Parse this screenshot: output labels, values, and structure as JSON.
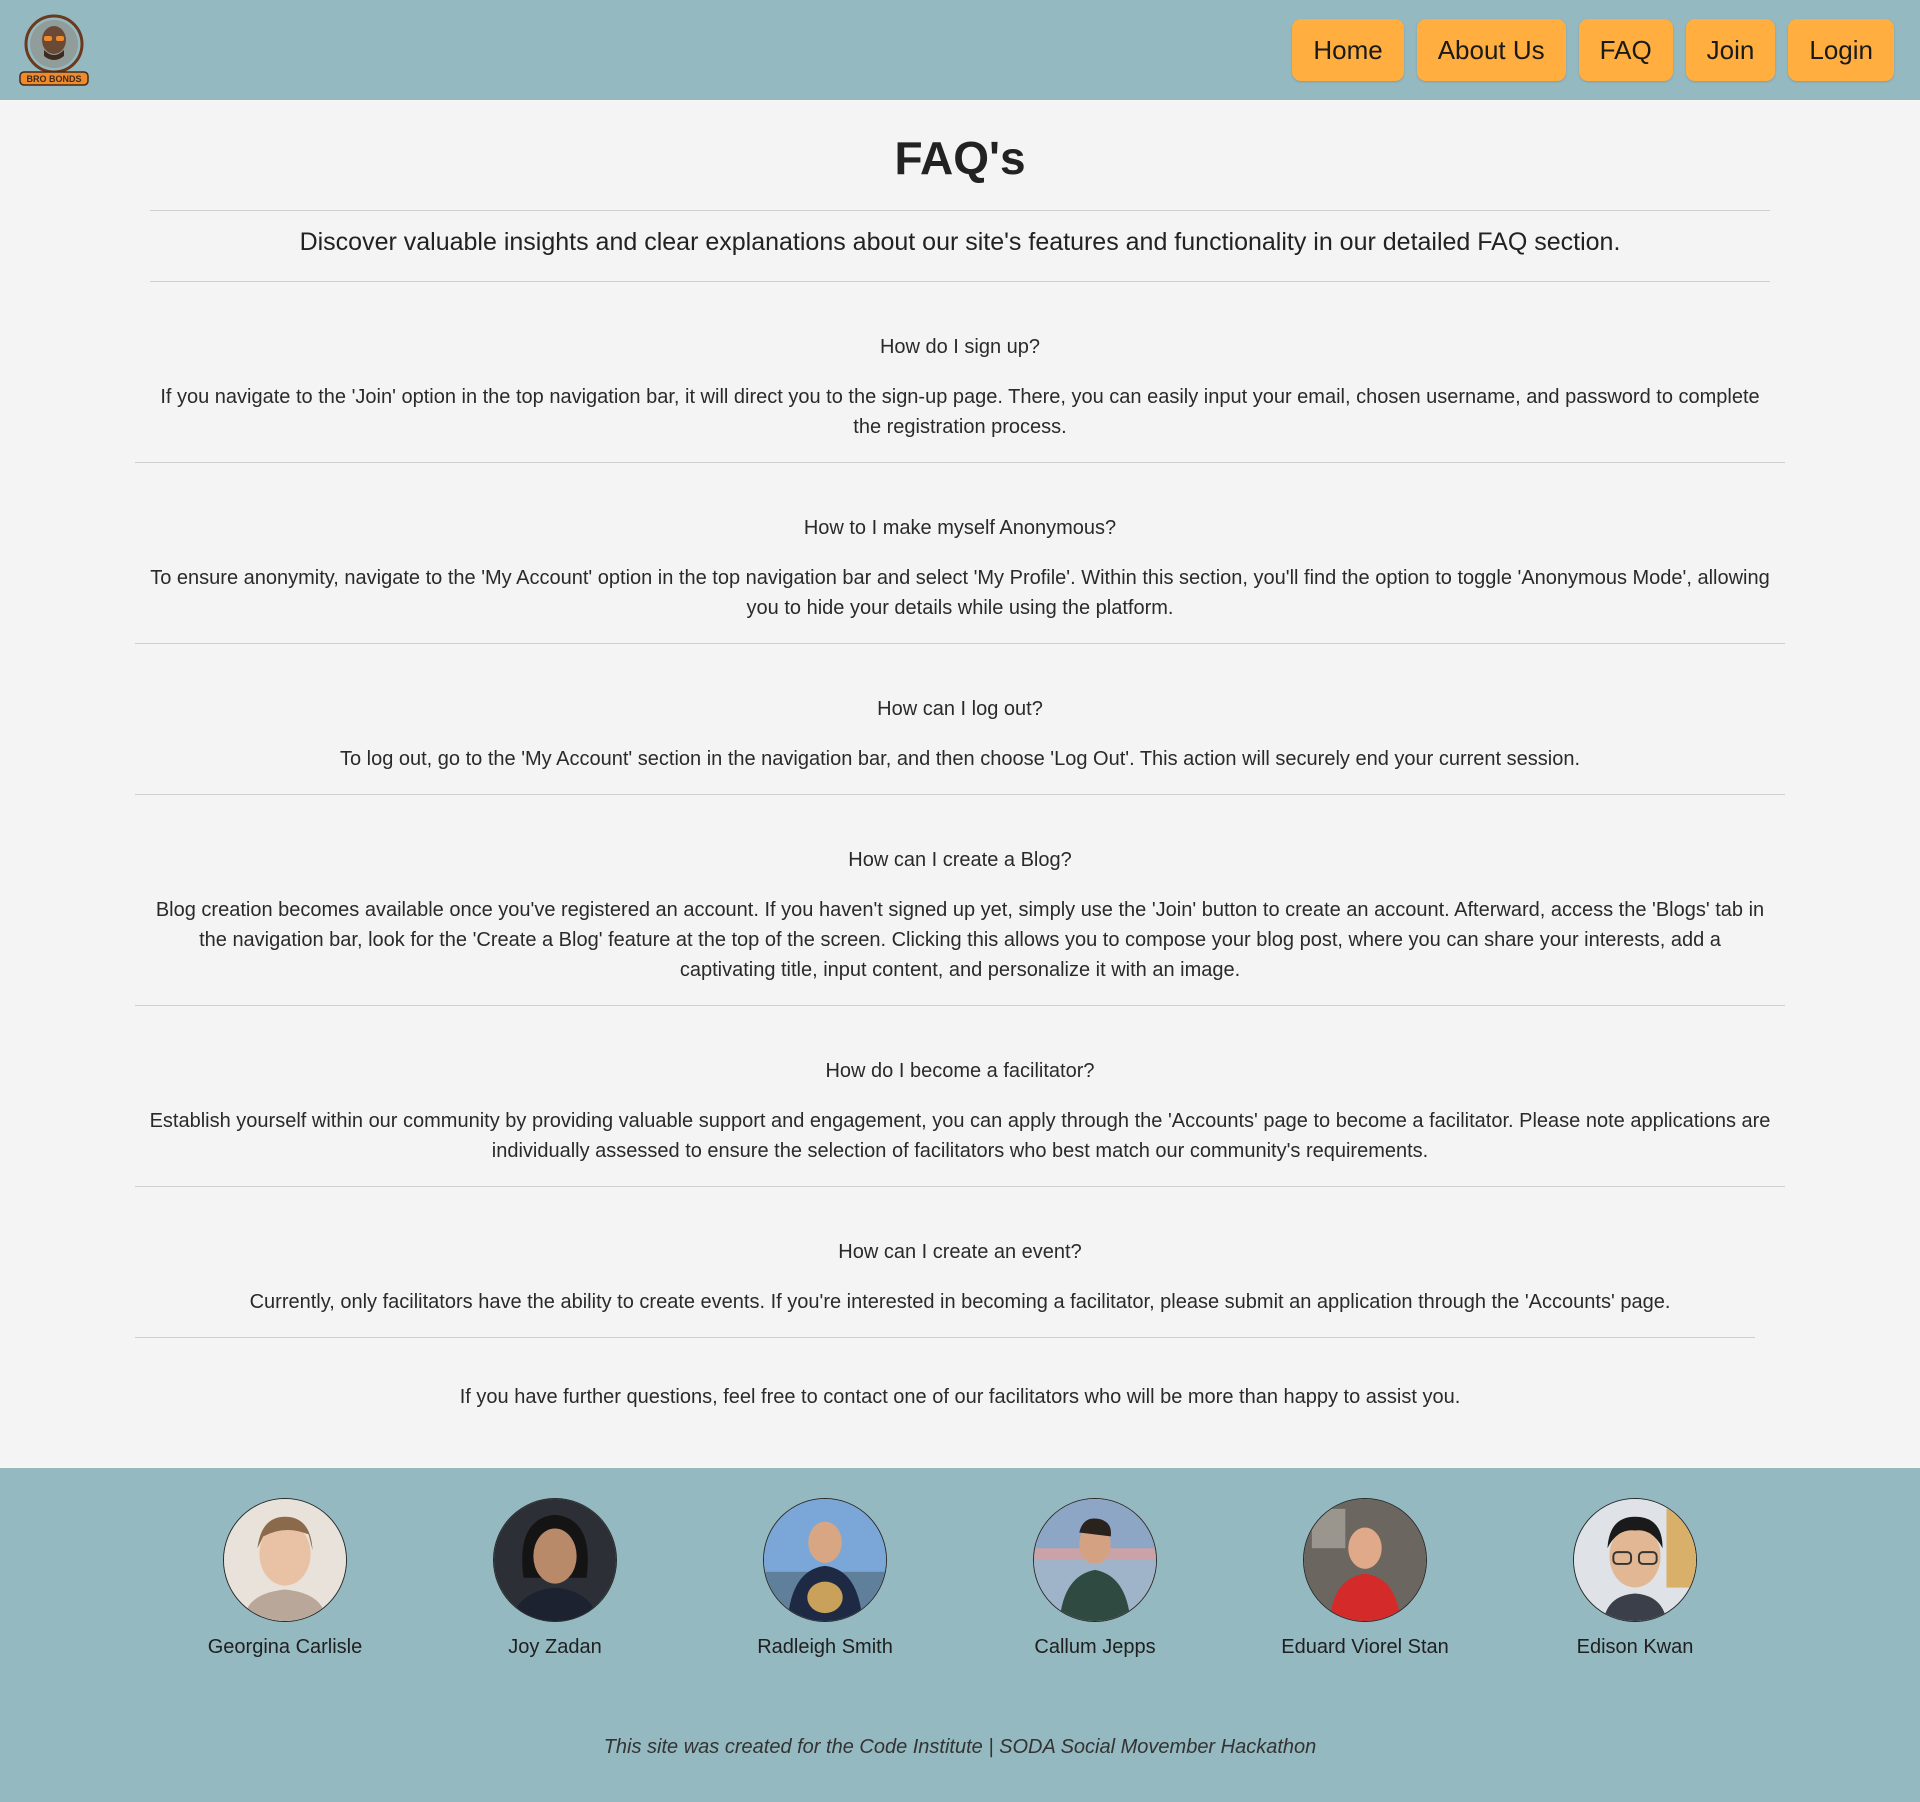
{
  "header": {
    "logo_text": "BRO BONDS",
    "nav": [
      {
        "label": "Home"
      },
      {
        "label": "About Us"
      },
      {
        "label": "FAQ"
      },
      {
        "label": "Join"
      },
      {
        "label": "Login"
      }
    ]
  },
  "page": {
    "title": "FAQ's",
    "subtitle": "Discover valuable insights and clear explanations about our site's features and functionality in our detailed FAQ section."
  },
  "faqs": [
    {
      "question": "How do I sign up?",
      "answer": "If you navigate to the 'Join' option in the top navigation bar, it will direct you to the sign-up page. There, you can easily input your email, chosen username, and password to complete the registration process."
    },
    {
      "question": "How to I make myself Anonymous?",
      "answer": "To ensure anonymity, navigate to the 'My Account' option in the top navigation bar and select 'My Profile'. Within this section, you'll find the option to toggle 'Anonymous Mode', allowing you to hide your details while using the platform."
    },
    {
      "question": "How can I log out?",
      "answer": "To log out, go to the 'My Account' section in the navigation bar, and then choose 'Log Out'. This action will securely end your current session."
    },
    {
      "question": "How can I create a Blog?",
      "answer": "Blog creation becomes available once you've registered an account. If you haven't signed up yet, simply use the 'Join' button to create an account. Afterward, access the 'Blogs' tab in the navigation bar, look for the 'Create a Blog' feature at the top of the screen. Clicking this allows you to compose your blog post, where you can share your interests, add a captivating title, input content, and personalize it with an image."
    },
    {
      "question": "How do I become a facilitator?",
      "answer": "Establish yourself within our community by providing valuable support and engagement, you can apply through the 'Accounts' page to become a facilitator. Please note applications are individually assessed to ensure the selection of facilitators who best match our community's requirements."
    },
    {
      "question": "How can I create an event?",
      "answer": "Currently, only facilitators have the ability to create events. If you're interested in becoming a facilitator, please submit an application through the 'Accounts' page."
    }
  ],
  "contact_text": "If you have further questions, feel free to contact one of our facilitators who will be more than happy to assist you.",
  "team": [
    {
      "name": "Georgina Carlisle"
    },
    {
      "name": "Joy Zadan"
    },
    {
      "name": "Radleigh Smith"
    },
    {
      "name": "Callum Jepps"
    },
    {
      "name": "Eduard Viorel Stan"
    },
    {
      "name": "Edison Kwan"
    }
  ],
  "footer": {
    "credit": "This site was created for the Code Institute | SODA Social Movember Hackathon"
  }
}
